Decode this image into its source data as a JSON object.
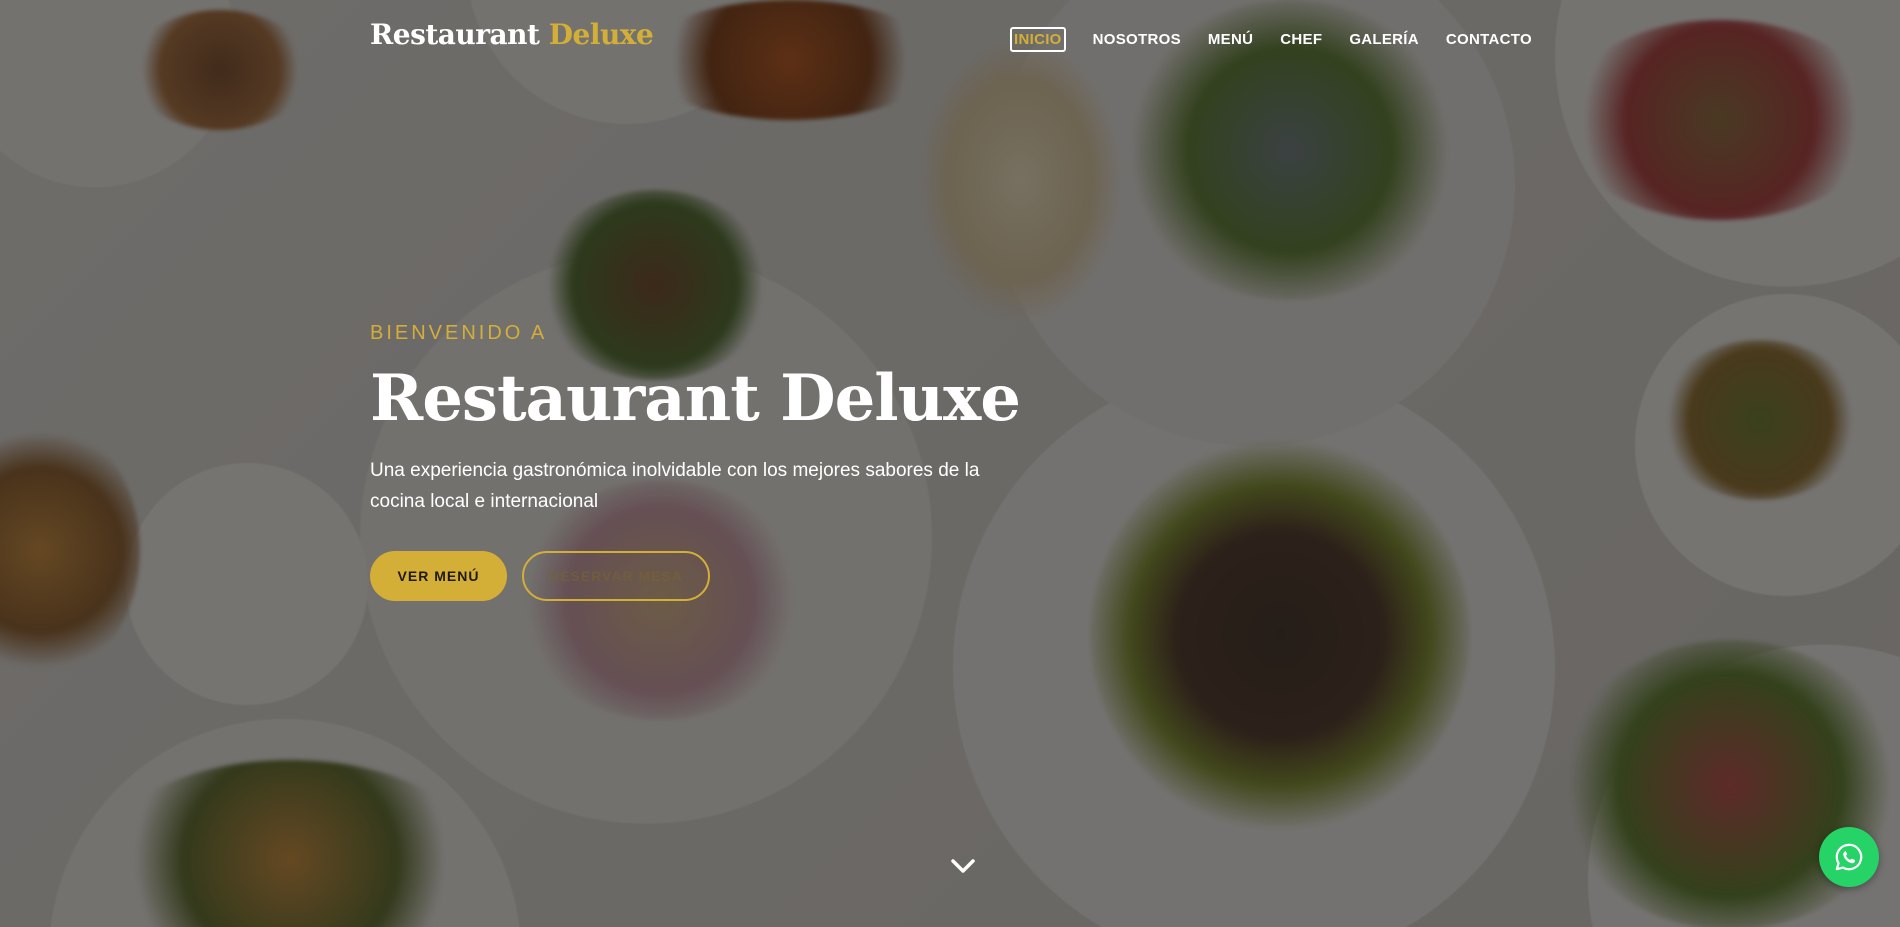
{
  "brand": {
    "name_part1": "Restaurant",
    "name_part2": "Deluxe"
  },
  "nav": {
    "items": [
      {
        "label": "INICIO",
        "active": true
      },
      {
        "label": "NOSOTROS",
        "active": false
      },
      {
        "label": "MENÚ",
        "active": false
      },
      {
        "label": "CHEF",
        "active": false
      },
      {
        "label": "GALERÍA",
        "active": false
      },
      {
        "label": "CONTACTO",
        "active": false
      }
    ]
  },
  "hero": {
    "eyebrow": "BIENVENIDO A",
    "title": "Restaurant Deluxe",
    "subtitle": "Una experiencia gastronómica inolvidable con los mejores sabores de la cocina local e internacional",
    "primary_button": "VER MENÚ",
    "secondary_button": "RESERVAR MESA"
  },
  "icons": {
    "scroll": "chevron-down-icon",
    "whatsapp": "whatsapp-icon"
  },
  "colors": {
    "accent": "#d4af37",
    "whatsapp": "#25d366",
    "text": "#ffffff"
  }
}
